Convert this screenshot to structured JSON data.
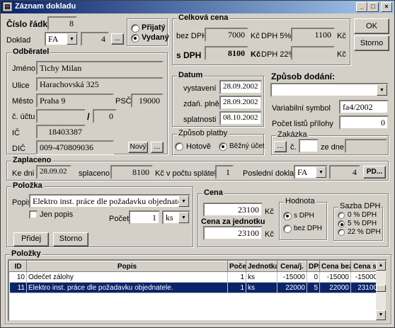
{
  "window": {
    "title": "Záznam dokladu",
    "minimize": "_",
    "maximize": "□",
    "close": "×"
  },
  "header": {
    "cislo_radku_label": "Číslo řádku",
    "cislo_radku": "8",
    "doklad_label": "Doklad",
    "doklad_typ": "FA",
    "doklad_cislo": "4",
    "browse": "...",
    "prijaty": "Přijatý",
    "vydany": "Vydaný"
  },
  "odberatel": {
    "title": "Odběratel",
    "jmeno_label": "Jméno",
    "jmeno": "Tichy Milan",
    "ulice_label": "Ulice",
    "ulice": "Harachovská  325",
    "mesto_label": "Město",
    "mesto": "Praha 9",
    "psc_label": "PSČ",
    "psc": "19000",
    "ucet_label": "č. účtu",
    "ucet": "",
    "ucet_sep": "/",
    "kod_banky": "0",
    "ic_label": "IČ",
    "ic": "18403387",
    "dic_label": "DIČ",
    "dic": "009-470809036",
    "novy": "Nový",
    "browse": "..."
  },
  "celkova_cena": {
    "title": "Celková cena",
    "bez_dph_label": "bez DPH",
    "bez_dph": "7000",
    "kc1": "Kč",
    "dph5_label": "DPH  5%",
    "dph5": "1100",
    "kc2": "Kč",
    "s_dph_label": "s DPH",
    "s_dph": "8100",
    "kc3": "Kč",
    "dph22_label": "DPH 22%",
    "dph22": "",
    "kc4": "Kč"
  },
  "buttons": {
    "ok": "OK",
    "storno": "Storno"
  },
  "datum": {
    "title": "Datum",
    "vystaveni_label": "vystavení",
    "vystaveni": "28.09.2002",
    "zdan_label": "zdaň. plnění",
    "zdan": "28.09.2002",
    "splatnost_label": "splatnosti",
    "splatnost": "08.10.2002"
  },
  "zpusob_platby": {
    "title": "Způsob platby",
    "hotove": "Hotově",
    "bezny": "Běžný účet"
  },
  "zpusob_dodani": {
    "title": "Způsob dodání:",
    "value": "",
    "vs_label": "Variabilní symbol",
    "vs": "fa4/2002",
    "listu_label": "Počet listů přílohy",
    "listu": "0"
  },
  "zakazka": {
    "title": "Zakázka",
    "browse": "...",
    "c_label": "č.",
    "cislo": "",
    "ze_dne_label": "ze dne",
    "ze_dne": ""
  },
  "zaplaceno": {
    "title": "Zaplaceno",
    "ke_dni_label": "Ke dni",
    "ke_dni": "28.09.02",
    "splaceno_label": "splaceno",
    "splaceno": "8100",
    "kc_label": "Kč  v počtu splátek",
    "splatek": "1",
    "posledni_label": "Poslední doklad",
    "posledni_typ": "FA",
    "posledni_cislo": "4",
    "pd": "PD..."
  },
  "polozka": {
    "title": "Položka",
    "popis_label": "Popis",
    "popis": "Elektro inst. práce dle požadavku objednatele.",
    "jen_popis": "Jen popis",
    "pocet_label": "Počet",
    "pocet": "1",
    "jednotka": "ks",
    "pridej": "Přidej",
    "storno": "Storno"
  },
  "cena": {
    "title": "Cena",
    "cena": "23100",
    "kc1": "Kč",
    "za_jednotku_label": "Cena za jednotku",
    "za_jednotku": "23100",
    "kc2": "Kč",
    "hodnota_title": "Hodnota",
    "s_dph": "s DPH",
    "bez_dph": "bez DPH",
    "sazba_title": "Sazba DPH",
    "s0": "0 % DPH",
    "s5": "5 % DPH",
    "s22": "22 % DPH"
  },
  "polozky": {
    "title": "Položky",
    "columns": [
      "ID",
      "Popis",
      "Počet",
      "Jednotka",
      "Cena/j.",
      "DPH",
      "Cena bez",
      "Cena s"
    ],
    "rows": [
      {
        "id": "10",
        "popis": "Odečet zálohy",
        "pocet": "1",
        "jednotka": "ks",
        "cena_j": "-15000",
        "dph": "0",
        "cena_bez": "-15000",
        "cena_s": "-15000"
      },
      {
        "id": "11",
        "popis": "Elektro inst. práce dle požadavku objednatele.",
        "pocet": "1",
        "jednotka": "ks",
        "cena_j": "22000",
        "dph": "5",
        "cena_bez": "22000",
        "cena_s": "23100"
      }
    ]
  }
}
